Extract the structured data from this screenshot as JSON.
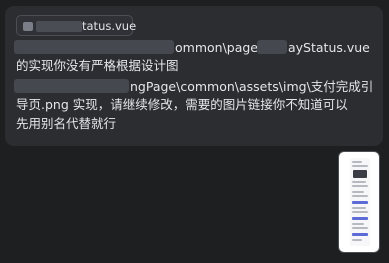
{
  "message": {
    "attachment_chip": {
      "icon": "file-icon",
      "filename_visible": "tatus.vue"
    },
    "lines": [
      "ommon\\page\\",
      "ayStatus.vue",
      "的实现你没有严格根据设计图",
      "ngPage\\common\\assets\\img\\支付完成引",
      "导页.png 实现，请继续修改，需要的图片链接你不知道可以",
      "先用别名代替就行"
    ]
  },
  "attachments": [
    {
      "type": "image-thumbnail",
      "icon": "image-thumbnail"
    }
  ],
  "colors": {
    "background": "#1e1f20",
    "bubble": "#2b2d31",
    "text": "#e6e6e9",
    "accent": "#5c6bd6"
  }
}
